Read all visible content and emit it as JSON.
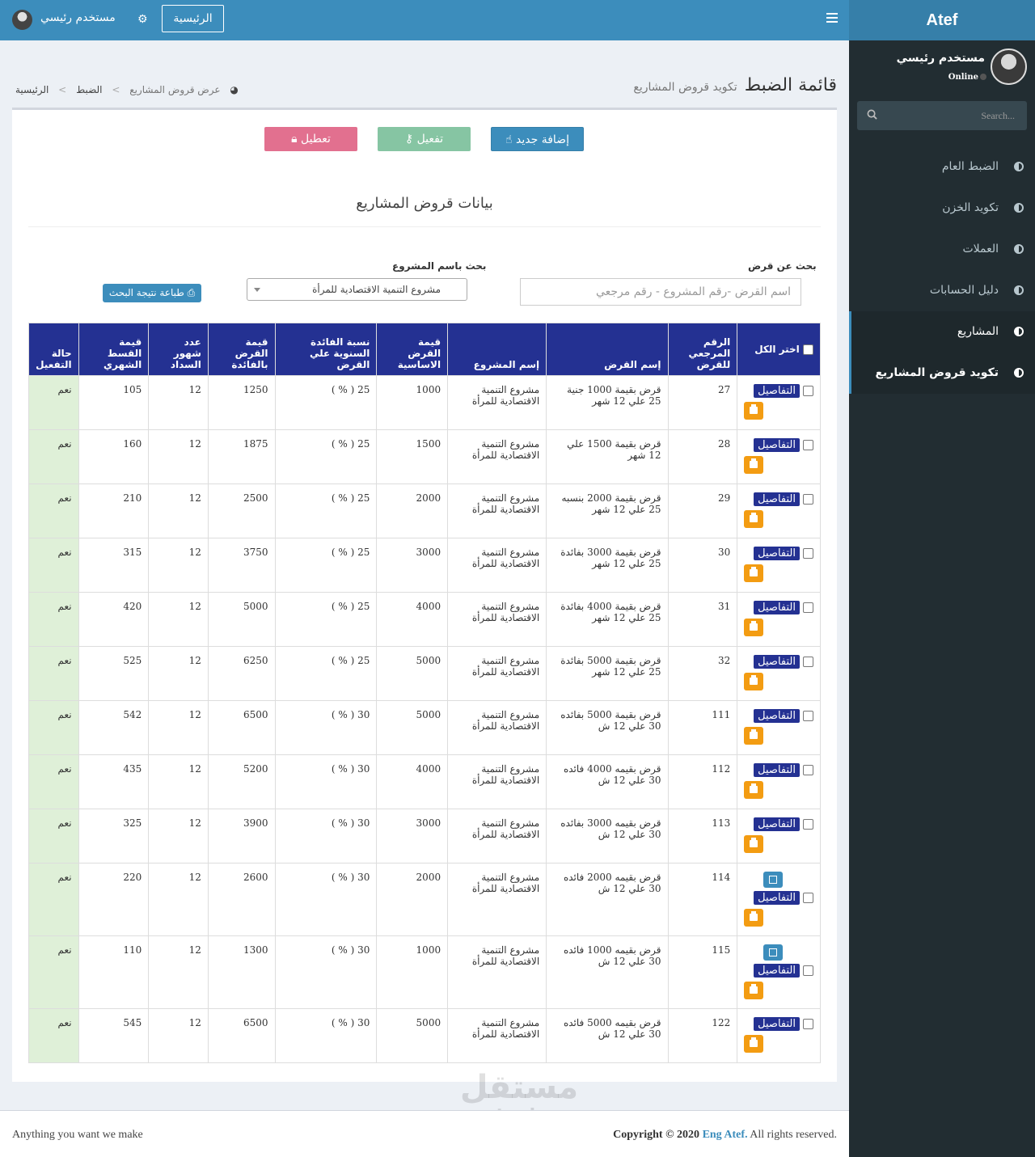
{
  "app": {
    "brand": "Atef"
  },
  "sidebar": {
    "user_name": "مستخدم رئيسي",
    "status": "Online",
    "search_placeholder": "Search...",
    "items": [
      {
        "label": "الضبط العام"
      },
      {
        "label": "تكويد الخزن"
      },
      {
        "label": "العملات"
      },
      {
        "label": "دليل الحسابات"
      },
      {
        "label": "المشاريع"
      },
      {
        "label": "تكويد قروض المشاريع"
      }
    ]
  },
  "topbar": {
    "home_label": "الرئيسية",
    "user_name": "مستخدم رئيسي"
  },
  "header": {
    "title": "قائمة الضبط",
    "subtitle": "تكويد قروض المشاريع",
    "breadcrumb": [
      "الرئيسية",
      "الضبط",
      "عرض قروض المشاريع"
    ]
  },
  "actions": {
    "new_label": "إضافة جديد",
    "activate_label": "تفعيل",
    "disable_label": "تعطيل"
  },
  "box": {
    "title": "بيانات قروض المشاريع"
  },
  "filters": {
    "loan_search_label": "بحث عن قرض",
    "loan_search_placeholder": "اسم القرض -رقم المشروع - رقم مرجعي",
    "project_search_label": "بحث باسم المشروع",
    "project_selected": "مشروع التنمية الاقتصادية للمرأة",
    "print_label": "طباعة نتيجة البحث"
  },
  "table": {
    "headers": [
      "اختر الكل",
      "الرقم المرجعي للقرض",
      "إسم القرض",
      "إسم المشروع",
      "قيمة القرض الاساسية",
      "نسبة الفائدة السنوية علي القرض",
      "قيمة القرض بالفائدة",
      "عدد شهور السداد",
      "قيمة القسط الشهري",
      "حالة التفعيل"
    ],
    "details_label": "التفاصيل",
    "rows": [
      {
        "ref": "27",
        "name": "قرض بقيمة 1000 جنية 25 علي 12 شهر",
        "project": "مشروع التنمية الاقتصادية للمرأة",
        "base": "1000",
        "rate": "25 ( % )",
        "total": "1250",
        "months": "12",
        "installment": "105",
        "status": "نعم",
        "edit": false
      },
      {
        "ref": "28",
        "name": "قرض بقيمة 1500 علي 12 شهر",
        "project": "مشروع التنمية الاقتصادية للمرأة",
        "base": "1500",
        "rate": "25 ( % )",
        "total": "1875",
        "months": "12",
        "installment": "160",
        "status": "نعم",
        "edit": false
      },
      {
        "ref": "29",
        "name": "قرض بقيمة 2000 بنسبه 25 علي 12 شهر",
        "project": "مشروع التنمية الاقتصادية للمرأة",
        "base": "2000",
        "rate": "25 ( % )",
        "total": "2500",
        "months": "12",
        "installment": "210",
        "status": "نعم",
        "edit": false
      },
      {
        "ref": "30",
        "name": "قرض بقيمة 3000 بفائدة 25 علي 12 شهر",
        "project": "مشروع التنمية الاقتصادية للمرأة",
        "base": "3000",
        "rate": "25 ( % )",
        "total": "3750",
        "months": "12",
        "installment": "315",
        "status": "نعم",
        "edit": false
      },
      {
        "ref": "31",
        "name": "قرض بقيمة 4000 بفائدة 25 علي 12 شهر",
        "project": "مشروع التنمية الاقتصادية للمرأة",
        "base": "4000",
        "rate": "25 ( % )",
        "total": "5000",
        "months": "12",
        "installment": "420",
        "status": "نعم",
        "edit": false
      },
      {
        "ref": "32",
        "name": "قرض بقيمة 5000 بفائدة 25 علي 12 شهر",
        "project": "مشروع التنمية الاقتصادية للمرأة",
        "base": "5000",
        "rate": "25 ( % )",
        "total": "6250",
        "months": "12",
        "installment": "525",
        "status": "نعم",
        "edit": false
      },
      {
        "ref": "111",
        "name": "قرض بقيمة 5000 بفائده 30 علي 12 ش",
        "project": "مشروع التنمية الاقتصادية للمرأة",
        "base": "5000",
        "rate": "30 ( % )",
        "total": "6500",
        "months": "12",
        "installment": "542",
        "status": "نعم",
        "edit": false
      },
      {
        "ref": "112",
        "name": "قرض بقيمه 4000 فائده 30 علي 12 ش",
        "project": "مشروع التنمية الاقتصادية للمرأة",
        "base": "4000",
        "rate": "30 ( % )",
        "total": "5200",
        "months": "12",
        "installment": "435",
        "status": "نعم",
        "edit": false
      },
      {
        "ref": "113",
        "name": "قرض بقيمه 3000 بفائده 30 علي 12 ش",
        "project": "مشروع التنمية الاقتصادية للمرأة",
        "base": "3000",
        "rate": "30 ( % )",
        "total": "3900",
        "months": "12",
        "installment": "325",
        "status": "نعم",
        "edit": false
      },
      {
        "ref": "114",
        "name": "قرض بقيمه 2000 فائده 30 علي 12 ش",
        "project": "مشروع التنمية الاقتصادية للمرأة",
        "base": "2000",
        "rate": "30 ( % )",
        "total": "2600",
        "months": "12",
        "installment": "220",
        "status": "نعم",
        "edit": true
      },
      {
        "ref": "115",
        "name": "قرض بقيمه 1000 فائده 30 علي 12 ش",
        "project": "مشروع التنمية الاقتصادية للمرأة",
        "base": "1000",
        "rate": "30 ( % )",
        "total": "1300",
        "months": "12",
        "installment": "110",
        "status": "نعم",
        "edit": true
      },
      {
        "ref": "122",
        "name": "قرض بقيمه 5000 فائده 30 علي 12 ش",
        "project": "مشروع التنمية الاقتصادية للمرأة",
        "base": "5000",
        "rate": "30 ( % )",
        "total": "6500",
        "months": "12",
        "installment": "545",
        "status": "نعم",
        "edit": false
      }
    ]
  },
  "footer": {
    "left": "Anything you want we make",
    "copyright_prefix": "Copyright © 2020",
    "author": "Eng Atef.",
    "copyright_suffix": "All rights reserved."
  },
  "watermark": {
    "line1": "مستقل",
    "line2": "mostaql.com"
  },
  "colors": {
    "sidebar": "#222d32",
    "topbar": "#3c8dbc",
    "table_header": "#243192",
    "print_button": "#f39c12",
    "status_bg": "#dff0d8"
  }
}
